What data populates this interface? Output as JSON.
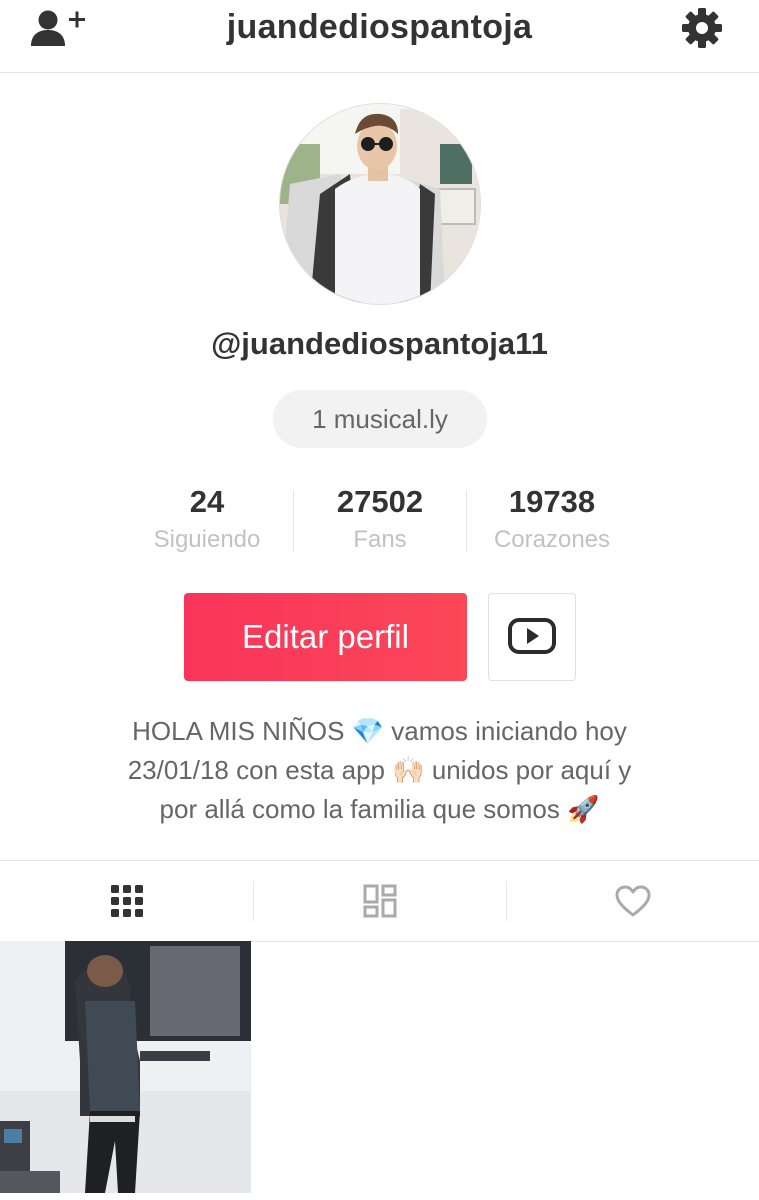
{
  "header": {
    "title": "juandediospantoja",
    "add_user_icon": "add-user-icon",
    "settings_icon": "gear-icon"
  },
  "profile": {
    "handle": "@juandediospantoja11",
    "videos_count_label": "1 musical.ly"
  },
  "stats": [
    {
      "value": "24",
      "label": "Siguiendo"
    },
    {
      "value": "27502",
      "label": "Fans"
    },
    {
      "value": "19738",
      "label": "Corazones"
    }
  ],
  "actions": {
    "edit_profile_label": "Editar perfil",
    "youtube_icon": "youtube-icon"
  },
  "bio": {
    "line1": "HOLA MIS NIÑOS 💎 vamos iniciando hoy",
    "line2": "23/01/18  con esta app 🙌🏻  unidos por aquí y",
    "line3": "por allá como la familia que somos 🚀"
  },
  "tabs": [
    {
      "icon": "grid-icon",
      "active": true
    },
    {
      "icon": "duet-grid-icon",
      "active": false
    },
    {
      "icon": "heart-icon",
      "active": false
    }
  ],
  "colors": {
    "accent": "#F9345A",
    "text_dark": "#333333",
    "text_muted": "#C2C2C2"
  }
}
